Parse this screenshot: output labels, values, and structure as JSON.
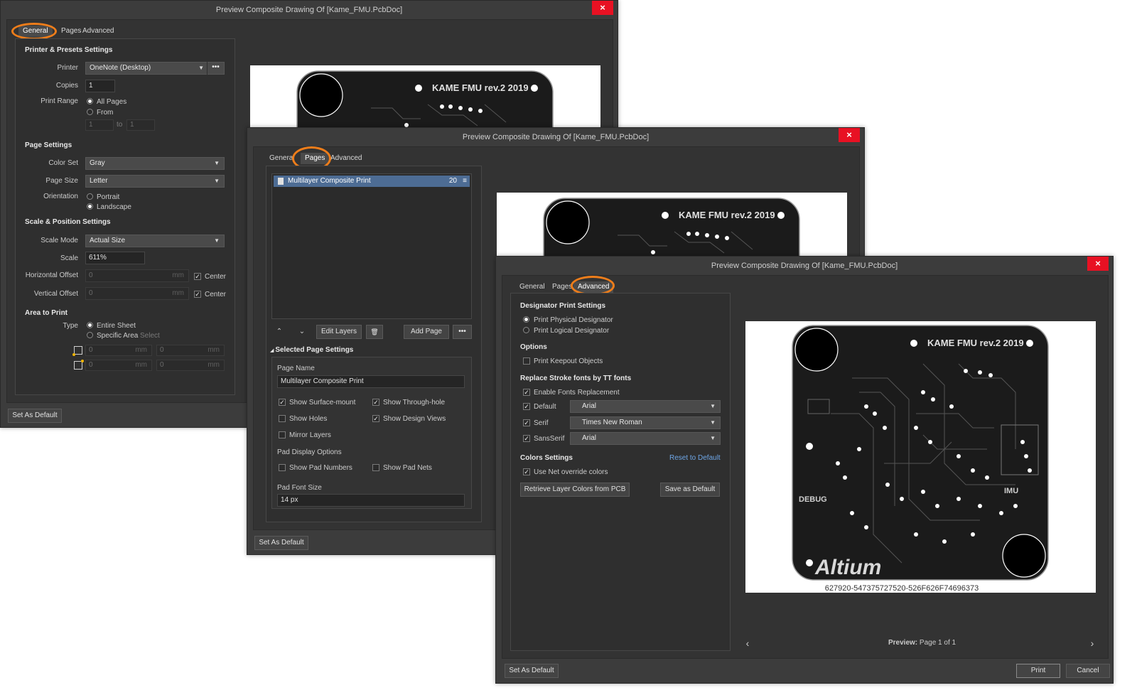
{
  "title": "Preview Composite Drawing Of [Kame_FMU.PcbDoc]",
  "tabs": {
    "general": "General",
    "pages": "Pages",
    "advanced": "Advanced"
  },
  "d1": {
    "tab_general": "General",
    "tab_pages": "Pages",
    "printer_presets_header": "Printer & Presets Settings",
    "printer_label": "Printer",
    "printer_value": "OneNote (Desktop)",
    "copies_label": "Copies",
    "copies_value": "1",
    "print_range_label": "Print Range",
    "all_pages": "All Pages",
    "from": "From",
    "range_from": "1",
    "range_to_label": "to",
    "range_to": "1",
    "page_settings_header": "Page Settings",
    "color_set_label": "Color Set",
    "color_set_value": "Gray",
    "page_size_label": "Page Size",
    "page_size_value": "Letter",
    "orientation_label": "Orientation",
    "portrait": "Portrait",
    "landscape": "Landscape",
    "scale_position_header": "Scale & Position Settings",
    "scale_mode_label": "Scale Mode",
    "scale_mode_value": "Actual Size",
    "scale_label": "Scale",
    "scale_value": "611%",
    "h_offset_label": "Horizontal Offset",
    "v_offset_label": "Vertical Offset",
    "offset_value": "0",
    "unit_mm": "mm",
    "center": "Center",
    "area_header": "Area to Print",
    "type_label": "Type",
    "entire_sheet": "Entire Sheet",
    "specific_area": "Specific Area",
    "select": "Select",
    "coord_value": "0",
    "set_default": "Set As Default"
  },
  "d2": {
    "tab_general": "General",
    "tab_pages": "Pages",
    "tab_advanced": "Advanced",
    "page_item": "Multilayer Composite Print",
    "page_count": "20",
    "edit_layers": "Edit Layers",
    "add_page": "Add Page",
    "selected_page_header": "Selected Page Settings",
    "page_name_label": "Page Name",
    "page_name_value": "Multilayer Composite Print",
    "show_surface_mount": "Show Surface-mount",
    "show_through_hole": "Show Through-hole",
    "show_holes": "Show Holes",
    "show_design_views": "Show Design Views",
    "mirror_layers": "Mirror Layers",
    "pad_display_header": "Pad Display Options",
    "show_pad_numbers": "Show Pad Numbers",
    "show_pad_nets": "Show Pad Nets",
    "pad_font_size_label": "Pad Font Size",
    "pad_font_size_value": "14 px",
    "set_default": "Set As Default"
  },
  "d3": {
    "tab_general": "General",
    "tab_pages": "Pages",
    "tab_advanced": "Advanced",
    "designator_header": "Designator Print Settings",
    "print_physical": "Print Physical Designator",
    "print_logical": "Print Logical Designator",
    "options_header": "Options",
    "print_keepout": "Print Keepout Objects",
    "replace_stroke_header": "Replace Stroke fonts by TT fonts",
    "enable_fonts_replacement": "Enable Fonts Replacement",
    "default_label": "Default",
    "default_font": "Arial",
    "serif_label": "Serif",
    "serif_font": "Times New Roman",
    "sansserif_label": "SansSerif",
    "sansserif_font": "Arial",
    "colors_header": "Colors Settings",
    "reset_default": "Reset to Default",
    "use_net_override": "Use Net override colors",
    "retrieve_colors": "Retrieve Layer Colors from PCB",
    "save_default": "Save as Default",
    "preview_label": "Preview:",
    "preview_page": "Page 1 of 1",
    "set_default": "Set As Default",
    "print": "Print",
    "cancel": "Cancel"
  },
  "pcb": {
    "board_title": "KAME FMU rev.2 2019",
    "label_debug": "DEBUG",
    "label_imu": "IMU",
    "brand": "Altium",
    "serial": "627920-547375727520-526F626F74696373"
  },
  "icons": {
    "close": "×",
    "caret": "▼",
    "more": "•••",
    "up": "⌃",
    "down": "⌄",
    "trash": "🗑",
    "ham": "≡",
    "prev": "‹",
    "next": "›",
    "check": "✓"
  }
}
